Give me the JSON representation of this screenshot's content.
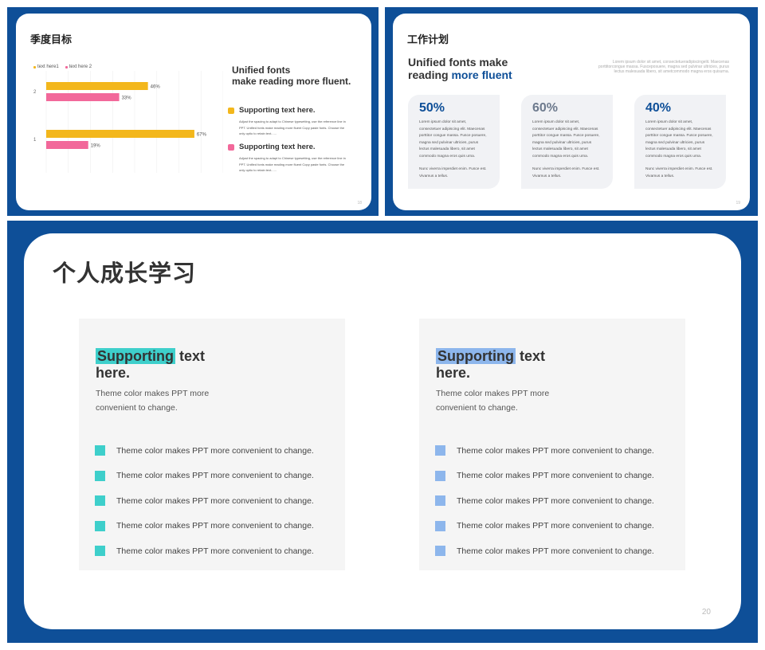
{
  "colors": {
    "frame": "#0e4f98",
    "yellow": "#f3b71c",
    "pink": "#f2689a",
    "teal": "#3ecfcb",
    "lightblue": "#8db6ec",
    "accent_blue": "#0e4f98"
  },
  "slideA": {
    "title": "季度目标",
    "page": "18",
    "legend": [
      {
        "label": "text here1",
        "color": "#f3b71c"
      },
      {
        "label": "text here 2",
        "color": "#f2689a"
      }
    ],
    "heading": "Unified fonts\nmake reading more fluent.",
    "points": [
      {
        "label": "Supporting text here.",
        "color": "#f3b71c",
        "desc": "Adjust the spacing to adapt to Chinese typesetting, use the reference line in PPT. Unified fonts make reading more fluent Copy paste fonts. Choose the only optio to retain text......"
      },
      {
        "label": "Supporting text here.",
        "color": "#f2689a",
        "desc": "Adjust the spacing to adapt to Chinese typesetting, use the reference line in PPT. Unified fonts make reading more fluent Copy paste fonts. Choose the only optio to retain text......"
      }
    ]
  },
  "chart_data": {
    "type": "bar",
    "orientation": "horizontal",
    "categories": [
      "2",
      "1"
    ],
    "series": [
      {
        "name": "text here1",
        "color": "#f3b71c",
        "values": [
          46,
          67
        ]
      },
      {
        "name": "text here 2",
        "color": "#f2689a",
        "values": [
          33,
          19
        ]
      }
    ],
    "value_labels": [
      [
        "46%",
        "67%"
      ],
      [
        "33%",
        "19%"
      ]
    ],
    "xlim": [
      0,
      80
    ],
    "grid": true,
    "legend": "top-left"
  },
  "slideB": {
    "title": "工作计划",
    "page": "19",
    "heading_plain": "Unified fonts make reading ",
    "heading_accent": "more fluent",
    "note": "Lorem ipsum dolor sit amet, consectetueradipiscingelit. Maecenas porttitorcongue massa. Fusceposuere, magna sed pulvinar ultricies, purus lectus malesuada libero, sit ametcommodo magna eros quisurna.",
    "stats": [
      {
        "pct": "50%",
        "color": "#0e4f98",
        "text": "Lorem ipsum dolor sit amet, consectetuer adipiscing elit. Maecenas porttitor congue massa. Fusce posuere, magna sed pulvinar ultricies, purus lectus malesuada libero, sit amet commodo magna eros quis urna.",
        "text2": "Nunc viverra imperdiet enim. Fusce est. Vivamus a tellus."
      },
      {
        "pct": "60%",
        "color": "#6d7a8d",
        "text": "Lorem ipsum dolor sit amet, consectetuer adipiscing elit. Maecenas porttitor congue massa. Fusce posuere, magna sed pulvinar ultricies, purus lectus malesuada libero, sit amet commodo magna eros quis urna.",
        "text2": "Nunc viverra imperdiet enim. Fusce est. Vivamus a tellus."
      },
      {
        "pct": "40%",
        "color": "#0e4f98",
        "text": "Lorem ipsum dolor sit amet, consectetuer adipiscing elit. Maecenas porttitor congue massa. Fusce posuere, magna sed pulvinar ultricies, purus lectus malesuada libero, sit amet commodo magna eros quis urna.",
        "text2": "Nunc viverra imperdiet enim. Fusce est. Vivamus a tellus."
      }
    ]
  },
  "slideC": {
    "title": "个人成长学习",
    "page": "20",
    "panels": [
      {
        "highlight": "Supporting",
        "rest": " text here.",
        "hl_color": "#3ecfcb",
        "sub": "Theme color makes PPT more convenient to change.",
        "bullet_color": "#3ecfcb",
        "items": [
          "Theme color makes PPT more convenient to change.",
          "Theme color makes PPT more convenient to change.",
          "Theme color makes PPT more convenient to change.",
          "Theme color makes PPT more convenient to change.",
          "Theme color makes PPT more convenient to change."
        ]
      },
      {
        "highlight": "Supporting",
        "rest": " text here.",
        "hl_color": "#8db6ec",
        "sub": "Theme color makes PPT more convenient to change.",
        "bullet_color": "#8db6ec",
        "items": [
          "Theme color makes PPT more convenient to change.",
          "Theme color makes PPT more convenient to change.",
          "Theme color makes PPT more convenient to change.",
          "Theme color makes PPT more convenient to change.",
          "Theme color makes PPT more convenient to change."
        ]
      }
    ]
  }
}
